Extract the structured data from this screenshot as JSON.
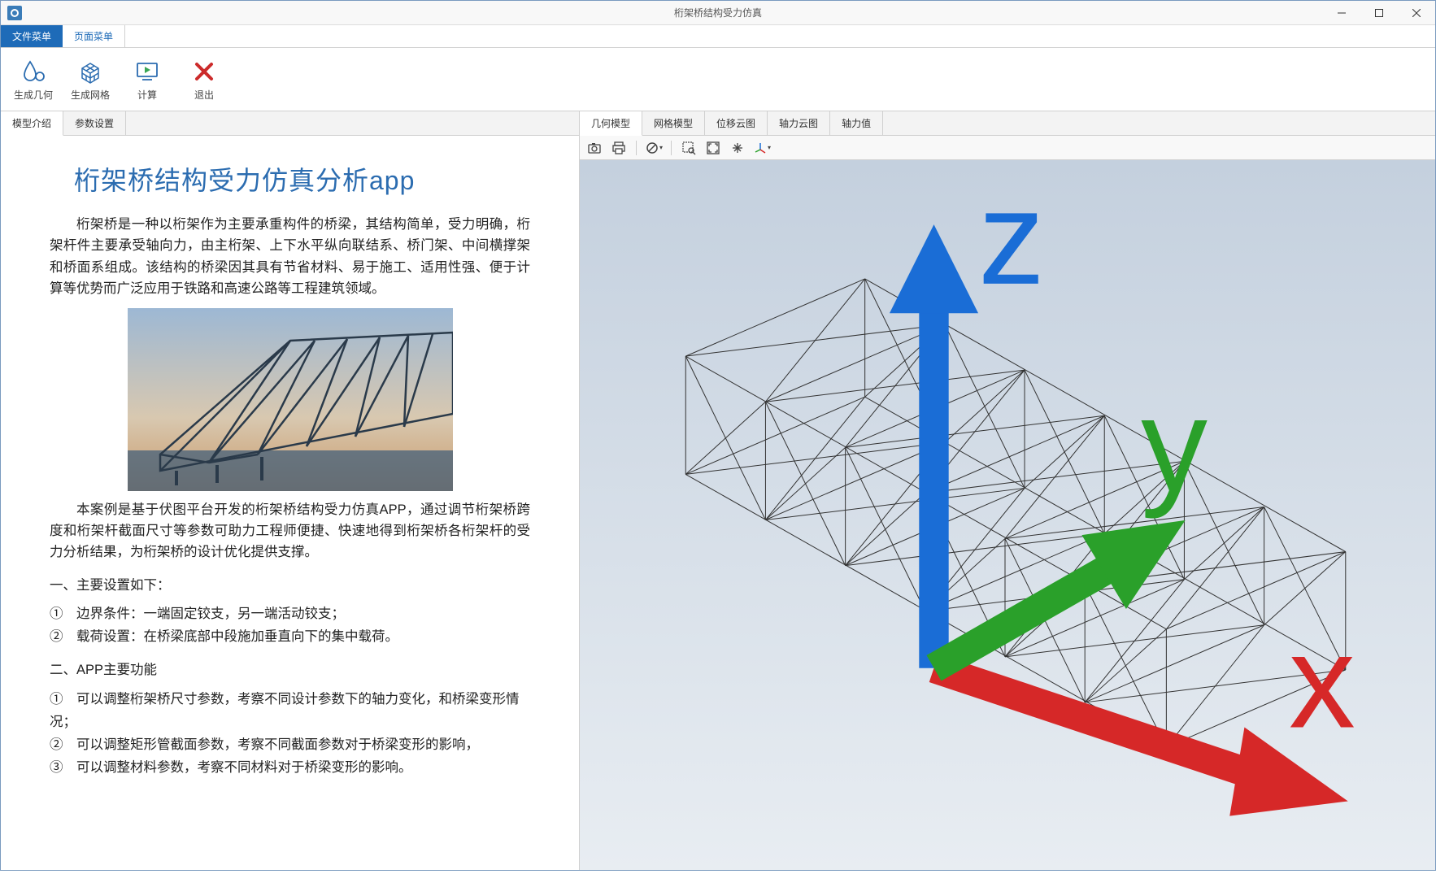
{
  "window": {
    "title": "桁架桥结构受力仿真"
  },
  "menu": {
    "file": "文件菜单",
    "page": "页面菜单"
  },
  "ribbon": {
    "gen_geom": "生成几何",
    "gen_mesh": "生成网格",
    "compute": "计算",
    "exit": "退出"
  },
  "left_tabs": {
    "intro": "模型介绍",
    "params": "参数设置"
  },
  "right_tabs": {
    "geom": "几何模型",
    "mesh": "网格模型",
    "disp": "位移云图",
    "axial_cloud": "轴力云图",
    "axial_val": "轴力值"
  },
  "article": {
    "title": "桁架桥结构受力仿真分析app",
    "p1": "桁架桥是一种以桁架作为主要承重构件的桥梁，其结构简单，受力明确，桁架杆件主要承受轴向力，由主桁架、上下水平纵向联结系、桥门架、中间横撑架和桥面系组成。该结构的桥梁因其具有节省材料、易于施工、适用性强、便于计算等优势而广泛应用于铁路和高速公路等工程建筑领域。",
    "p2": "本案例是基于伏图平台开发的桁架桥结构受力仿真APP，通过调节桁架桥跨度和桁架杆截面尺寸等参数可助力工程师便捷、快速地得到桁架桥各桁架杆的受力分析结果，为桁架桥的设计优化提供支撑。",
    "sec1": "一、主要设置如下：",
    "l1": "①　边界条件：一端固定铰支，另一端活动铰支；",
    "l2": "②　载荷设置：在桥梁底部中段施加垂直向下的集中载荷。",
    "sec2": "二、APP主要功能",
    "f1": "①　可以调整桁架桥尺寸参数，考察不同设计参数下的轴力变化，和桥梁变形情况；",
    "f2": "②　可以调整矩形管截面参数，考察不同截面参数对于桥梁变形的影响，",
    "f3": "③　可以调整材料参数，考察不同材料对于桥梁变形的影响。"
  },
  "axis": {
    "x": "x",
    "y": "y",
    "z": "z"
  }
}
